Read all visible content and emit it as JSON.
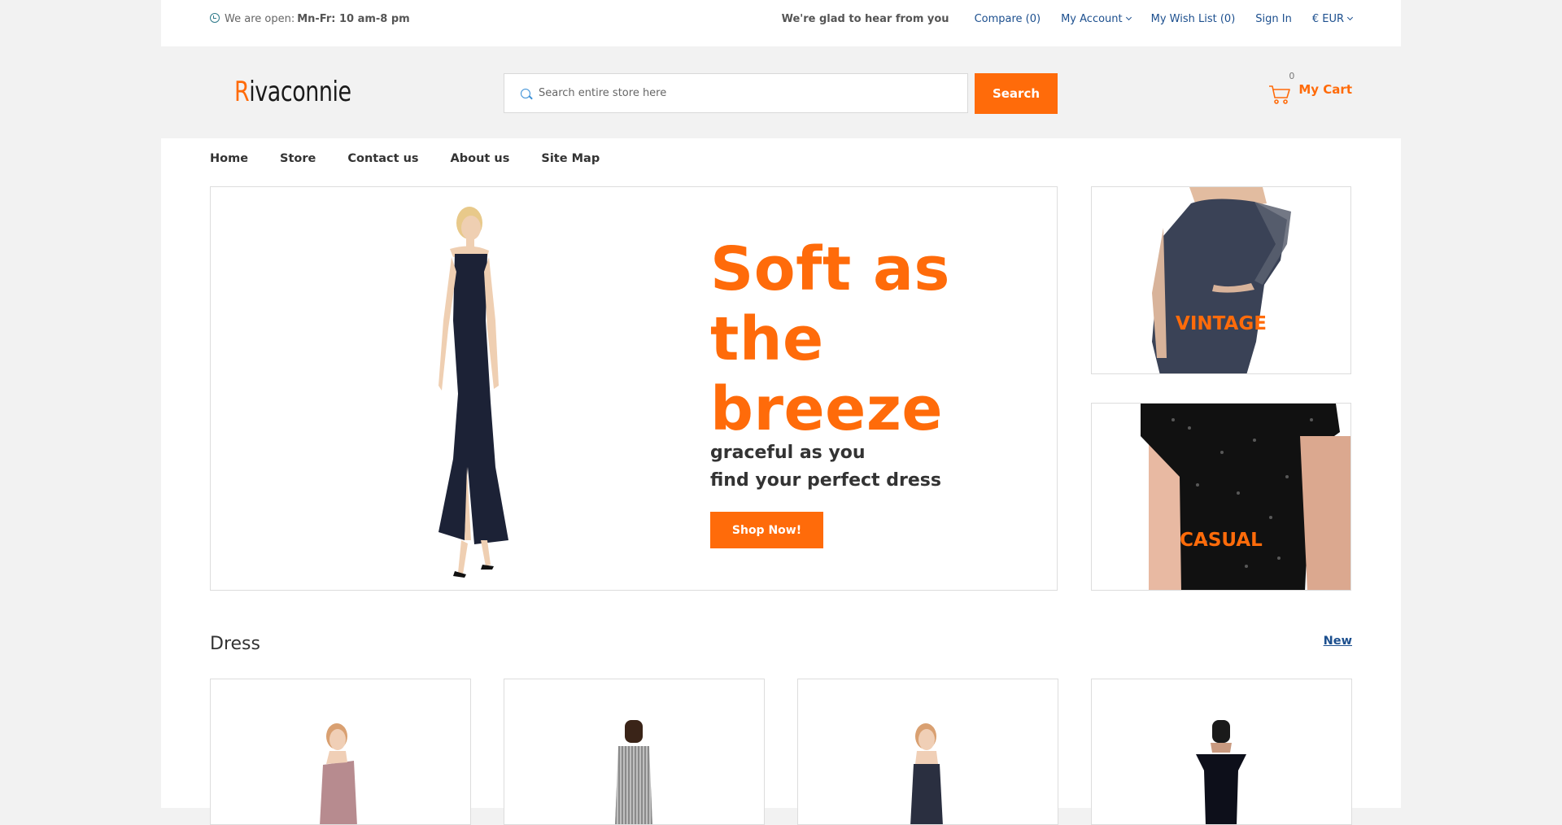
{
  "topbar": {
    "open_prefix": "We are open:",
    "open_hours": "Mn-Fr: 10 am-8 pm",
    "glad_text": "We're glad to hear from you",
    "compare": "Compare (0)",
    "my_account": "My Account",
    "wish_list": "My Wish List (0)",
    "sign_in": "Sign In",
    "currency": "€ EUR"
  },
  "header": {
    "logo_first": "R",
    "logo_rest": "ivaconnie",
    "search_placeholder": "Search entire store here",
    "search_button": "Search",
    "cart_count": "0",
    "cart_label": "My Cart"
  },
  "nav": {
    "items": [
      "Home",
      "Store",
      "Contact us",
      "About us",
      "Site Map"
    ]
  },
  "hero": {
    "headline": [
      "Soft as",
      "the",
      "breeze"
    ],
    "sub_line1": "graceful as you",
    "sub_line2": "find your perfect dress",
    "cta": "Shop Now!"
  },
  "promos": {
    "vintage": "VINTAGE",
    "casual": "CASUAL"
  },
  "section": {
    "title": "Dress",
    "link": "New"
  },
  "colors": {
    "accent": "#ff6b0a",
    "link": "#1c4f8e"
  },
  "icons": [
    "clock-icon",
    "chevron-down-icon",
    "search-icon",
    "cart-icon"
  ]
}
